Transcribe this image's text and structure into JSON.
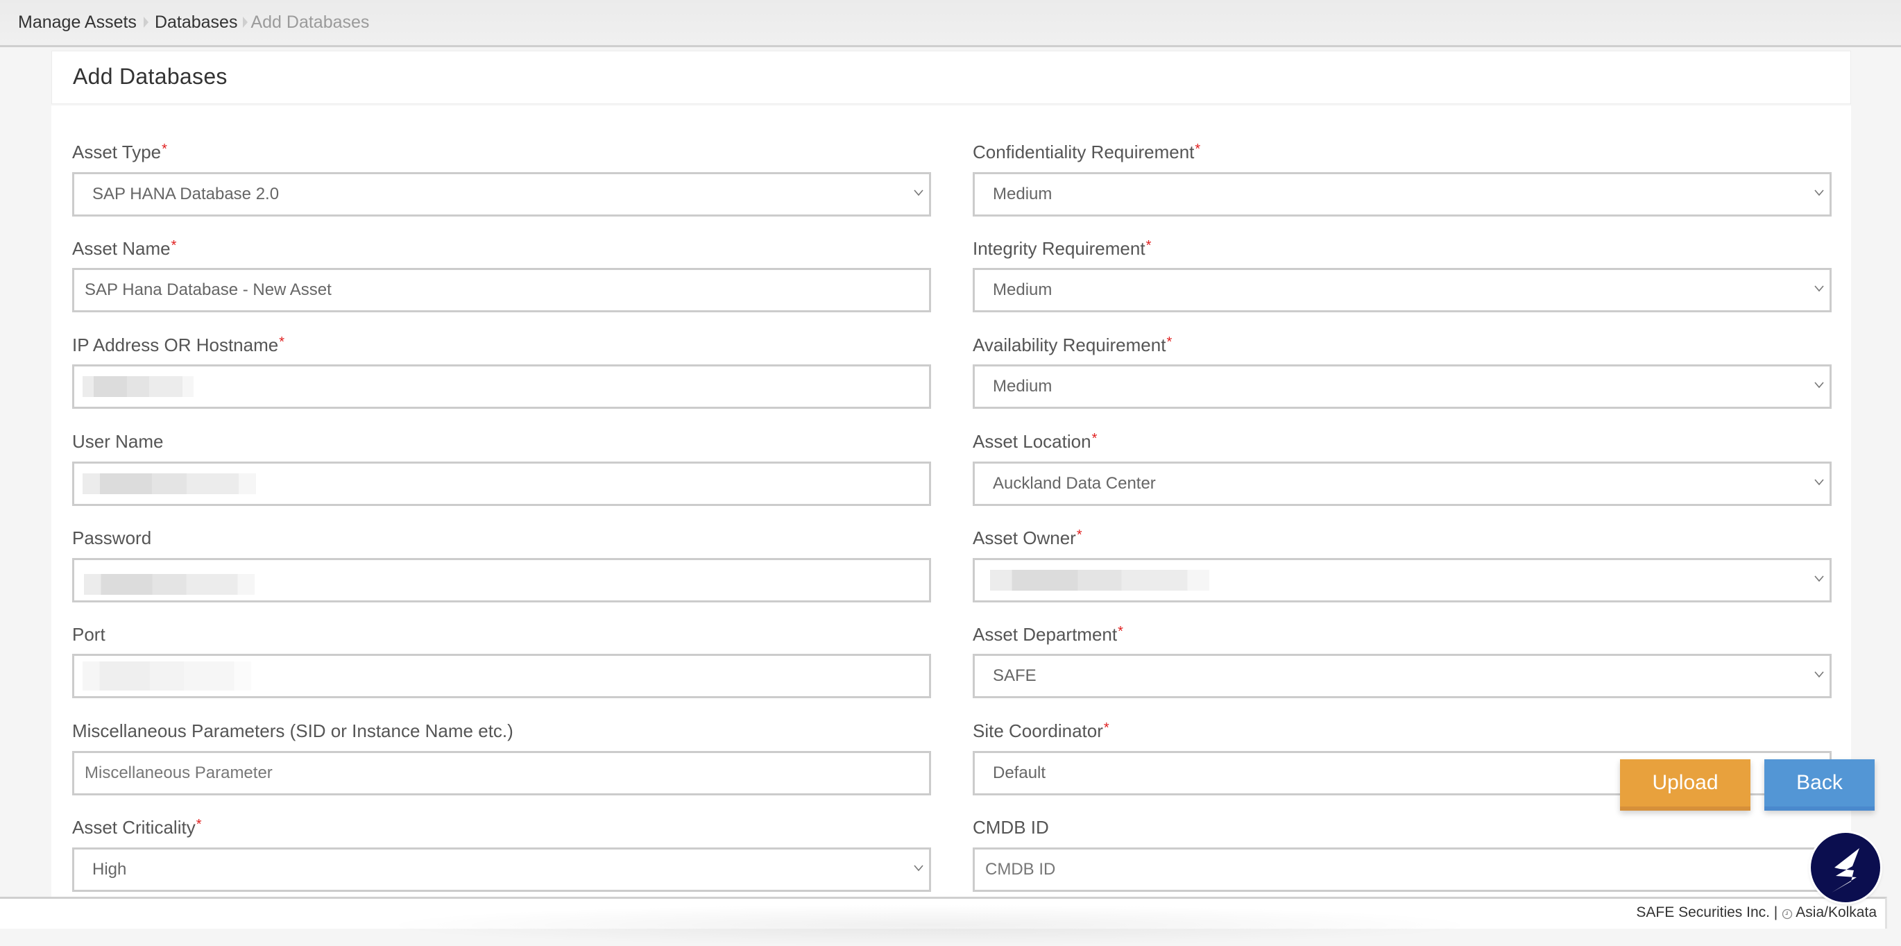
{
  "breadcrumb": {
    "items": [
      {
        "label": "Manage Assets"
      },
      {
        "label": "Databases"
      },
      {
        "label": "Add Databases"
      }
    ]
  },
  "page": {
    "title": "Add Databases"
  },
  "form": {
    "left": [
      {
        "label": "Asset Type",
        "required": "*",
        "type": "select",
        "value": "SAP HANA Database 2.0"
      },
      {
        "label": "Asset Name",
        "required": "*",
        "type": "input",
        "value": "SAP Hana Database - New Asset"
      },
      {
        "label": "IP Address OR Hostname",
        "required": "*",
        "type": "input",
        "value": "[redacted]"
      },
      {
        "label": "User Name",
        "required": "",
        "type": "input",
        "value": "[redacted]"
      },
      {
        "label": "Password",
        "required": "",
        "type": "input",
        "value": "[redacted]"
      },
      {
        "label": "Port",
        "required": "",
        "type": "input",
        "value": "[redacted]"
      },
      {
        "label": "Miscellaneous Parameters (SID or Instance Name etc.)",
        "required": "",
        "type": "input",
        "placeholder": "Miscellaneous Parameter"
      },
      {
        "label": "Asset Criticality",
        "required": "*",
        "type": "select",
        "value": "High"
      }
    ],
    "right": [
      {
        "label": "Confidentiality Requirement",
        "required": "*",
        "type": "select",
        "value": "Medium"
      },
      {
        "label": "Integrity Requirement",
        "required": "*",
        "type": "select",
        "value": "Medium"
      },
      {
        "label": "Availability Requirement",
        "required": "*",
        "type": "select",
        "value": "Medium"
      },
      {
        "label": "Asset Location",
        "required": "*",
        "type": "select",
        "value": "Auckland Data Center"
      },
      {
        "label": "Asset Owner",
        "required": "*",
        "type": "select",
        "value": "[redacted]"
      },
      {
        "label": "Asset Department",
        "required": "*",
        "type": "select",
        "value": "SAFE"
      },
      {
        "label": "Site Coordinator",
        "required": "*",
        "type": "select",
        "value": "Default"
      },
      {
        "label": "CMDB ID",
        "required": "",
        "type": "input",
        "placeholder": "CMDB ID"
      }
    ]
  },
  "actions": {
    "upload_label": "Upload",
    "back_label": "Back",
    "upload_color": "#e8a13d",
    "back_color": "#5396d5"
  },
  "footer": {
    "company": "SAFE Securities Inc. |",
    "timezone": "Asia/Kolkata"
  },
  "logo": {
    "icon": "safe-logo-icon",
    "color": "#0b0e4f"
  }
}
